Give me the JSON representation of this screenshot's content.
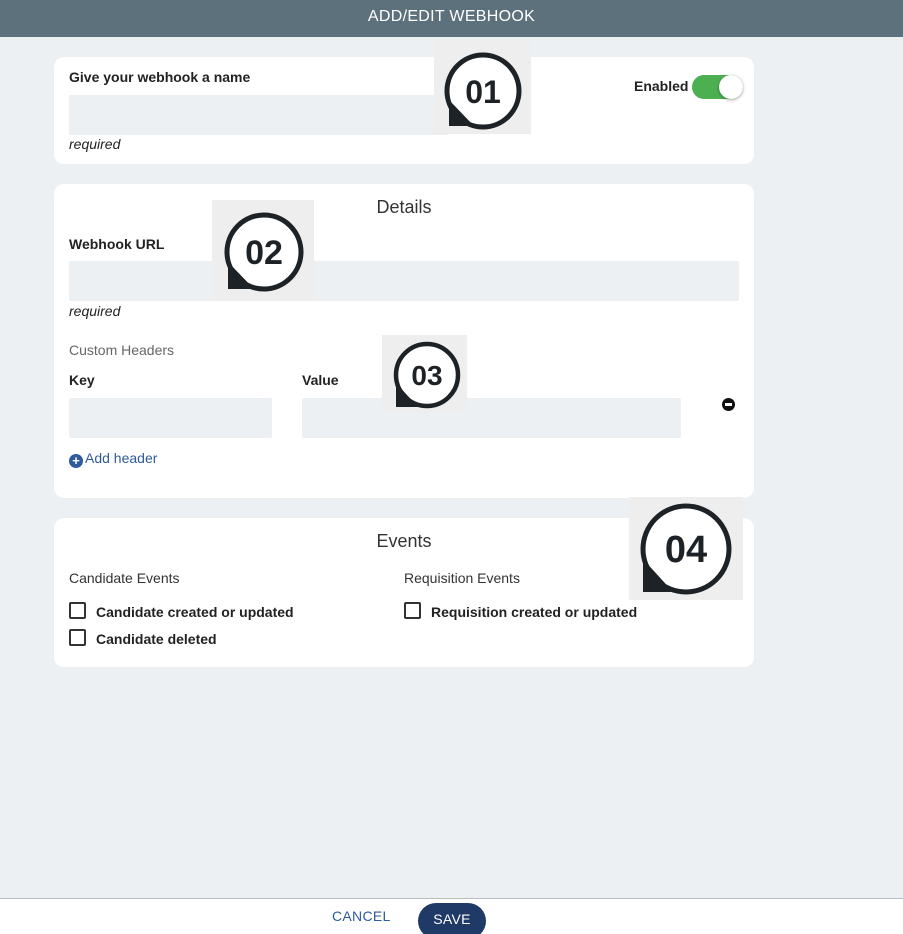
{
  "header": {
    "title": "ADD/EDIT WEBHOOK"
  },
  "name_card": {
    "label": "Give your webhook a name",
    "value": "",
    "hint": "required",
    "enabled_label": "Enabled",
    "enabled": true
  },
  "details": {
    "title": "Details",
    "url_label": "Webhook URL",
    "url_value": "",
    "url_hint": "required",
    "custom_headers_label": "Custom Headers",
    "key_label": "Key",
    "value_label": "Value",
    "add_header_label": "Add header"
  },
  "events": {
    "title": "Events",
    "candidate_group": "Candidate Events",
    "candidate_items": [
      "Candidate created or updated",
      "Candidate deleted"
    ],
    "requisition_group": "Requisition Events",
    "requisition_items": [
      "Requisition created or updated"
    ]
  },
  "badges": [
    "01",
    "02",
    "03",
    "04"
  ],
  "footer": {
    "cancel_label": "CANCEL",
    "save_label": "SAVE"
  },
  "colors": {
    "topbar": "#5d717c",
    "toggle_on": "#4caf50",
    "primary": "#1f3a66",
    "link": "#2f5b9a",
    "background": "#ecf0f2"
  }
}
